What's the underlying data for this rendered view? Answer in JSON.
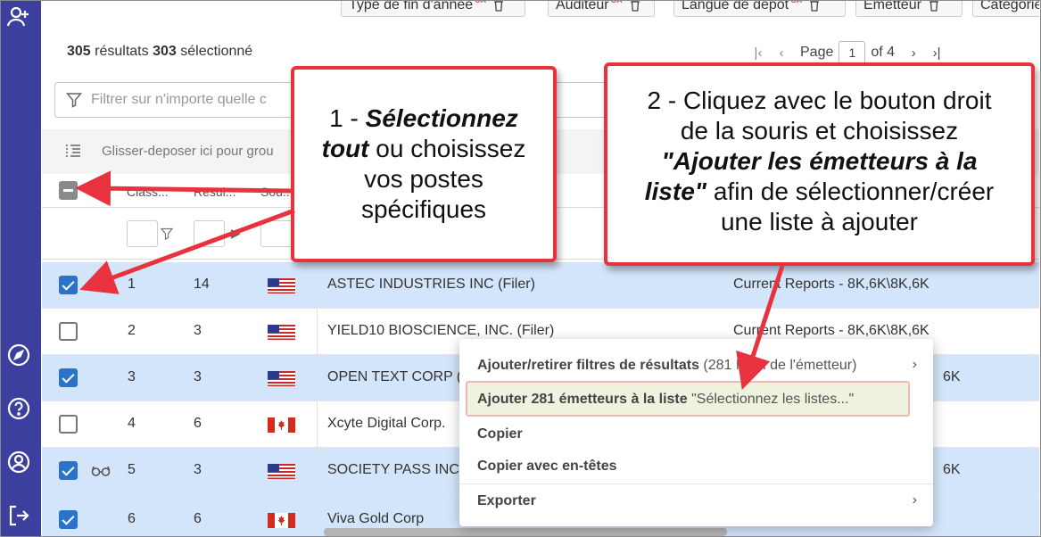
{
  "toolbar": {
    "chips": [
      {
        "label": "Type de fin d'année"
      },
      {
        "label": "Auditeur"
      },
      {
        "label": "Langue de dépôt"
      },
      {
        "label": "Émetteur"
      },
      {
        "label": "Catégorie"
      }
    ],
    "ca_badge": "CA"
  },
  "results": {
    "count": "305",
    "count_label": "résultats",
    "selected": "303",
    "selected_label": "sélectionné"
  },
  "pager": {
    "page_label": "Page",
    "current": "1",
    "of_label": "of 4"
  },
  "filter": {
    "placeholder": "Filtrer sur n'importe quelle c"
  },
  "group_bar": {
    "text": "Glisser-deposer ici pour grou"
  },
  "grid": {
    "columns": [
      "Class...",
      "Résul...",
      "Sou..."
    ],
    "rows": [
      {
        "num": "1",
        "count": "14",
        "name": "ASTEC INDUSTRIES INC (Filer)",
        "category": "Current Reports - 8K,6K\\8K,6K",
        "selected": true,
        "flag": "us"
      },
      {
        "num": "2",
        "count": "3",
        "name": "YIELD10 BIOSCIENCE, INC. (Filer)",
        "category": "Current Reports - 8K,6K\\8K,6K",
        "selected": false,
        "flag": "us"
      },
      {
        "num": "3",
        "count": "3",
        "name": "OPEN TEXT CORP (",
        "category": "6K",
        "selected": true,
        "flag": "us"
      },
      {
        "num": "4",
        "count": "6",
        "name": "Xcyte Digital Corp.",
        "category": "",
        "selected": false,
        "flag": "ca"
      },
      {
        "num": "5",
        "count": "3",
        "name": "SOCIETY PASS INCO",
        "category": "6K",
        "selected": true,
        "flag": "us"
      },
      {
        "num": "6",
        "count": "6",
        "name": "Viva Gold Corp",
        "category": "",
        "selected": true,
        "flag": "ca"
      }
    ]
  },
  "context_menu": {
    "item1_bold": "Ajouter/retirer filtres de résultats",
    "item1_rest": "(281 Nom de l'émetteur)",
    "item2_bold": "Ajouter 281 émetteurs à la liste",
    "item2_rest": "\"Sélectionnez les listes...\"",
    "item3": "Copier",
    "item4": "Copier avec en-têtes",
    "item5": "Exporter"
  },
  "callout1": {
    "line1_a": "1 - ",
    "line1_b": "Sélectionnez",
    "line2_b": "tout",
    "line2_a": " ou choisissez",
    "line3": "vos postes",
    "line4": "spécifiques"
  },
  "callout2": {
    "line1": "2 - Cliquez avec le bouton droit",
    "line2": "de la souris et choisissez",
    "line3": "\"Ajouter les émetteurs à la",
    "line4_b": "liste\"",
    "line4_a": " afin de sélectionner/créer",
    "line5": "une liste à ajouter"
  },
  "colors": {
    "sidebar": "#3d3f9e",
    "selected_row": "#d3e5fa",
    "checkbox_on": "#2b73c8",
    "callout_border": "#e8333f",
    "menu_highlight": "#eef2df"
  }
}
